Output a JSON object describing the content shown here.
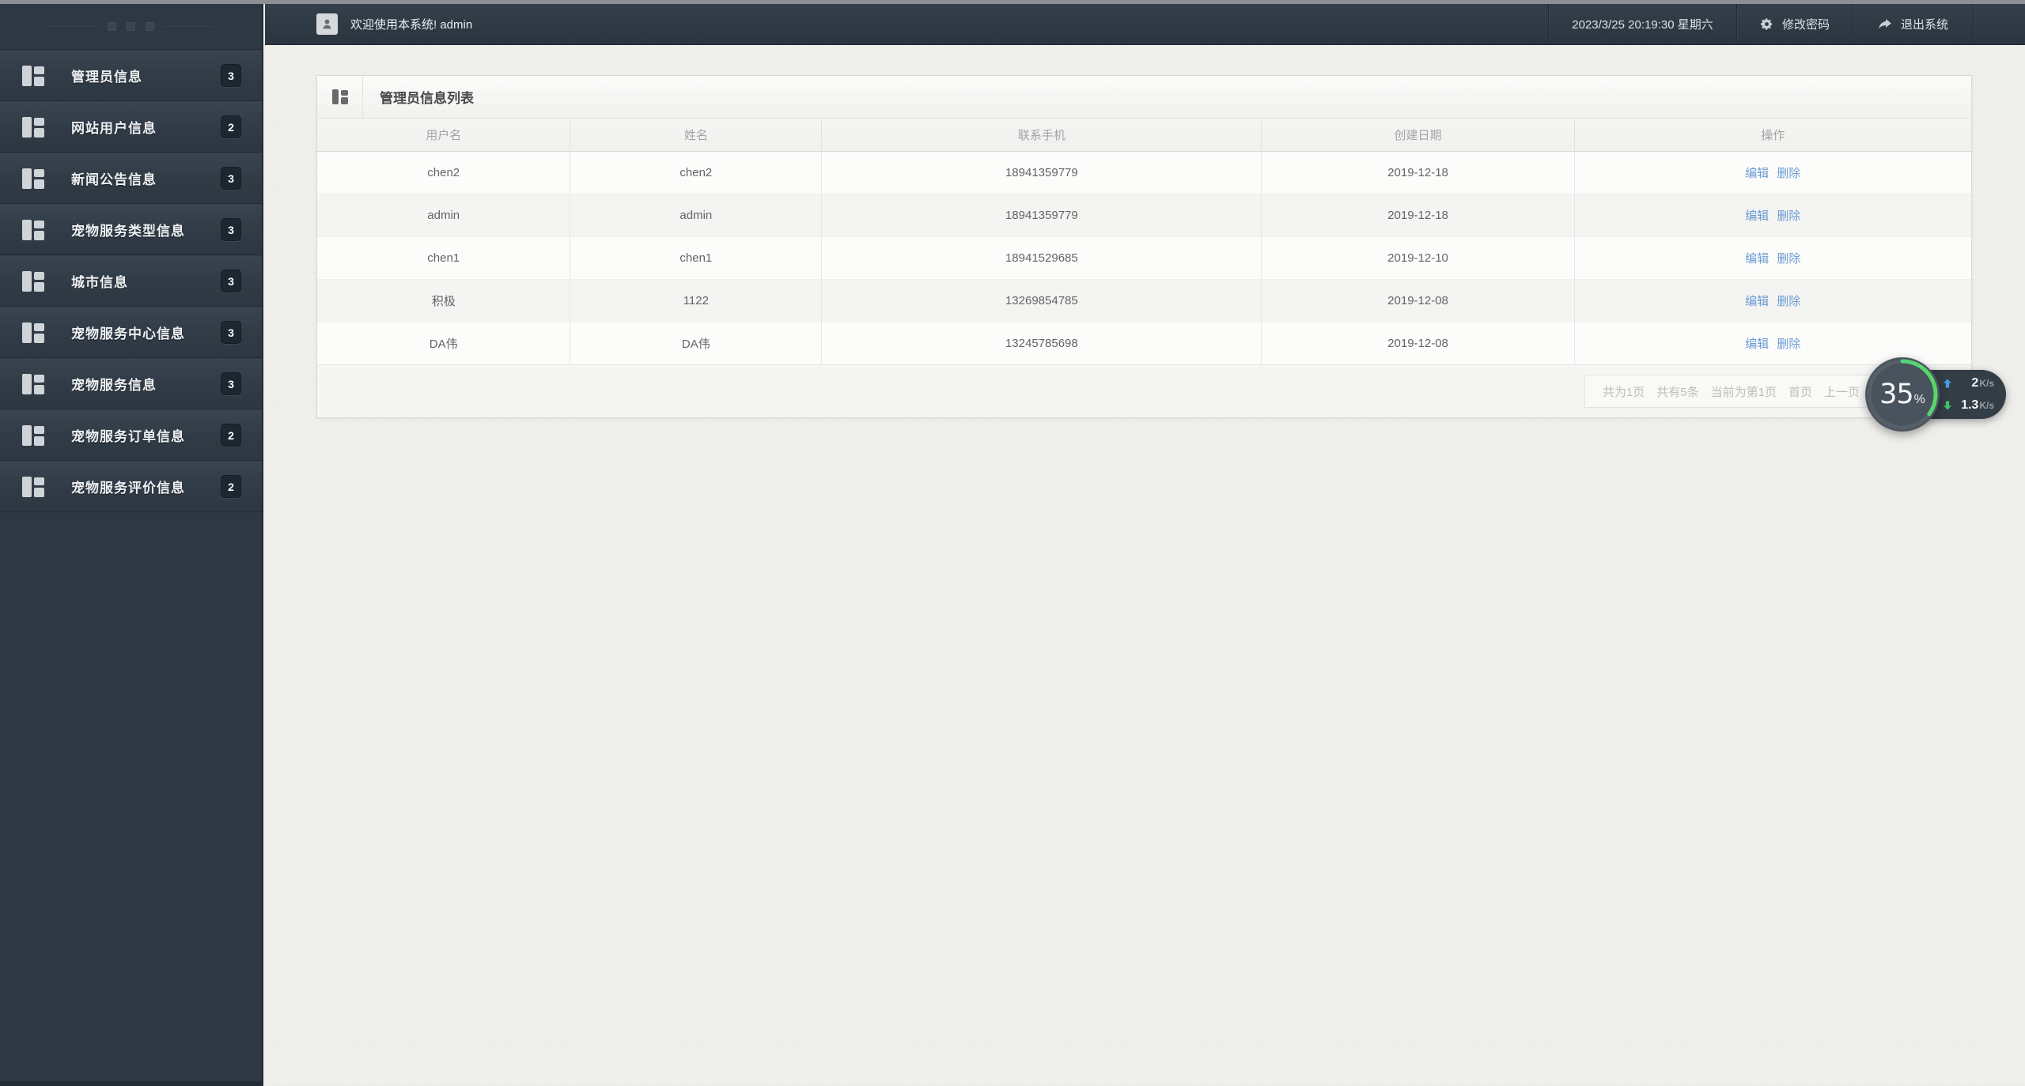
{
  "topbar": {
    "welcome_text": "欢迎使用本系统! admin",
    "datetime": "2023/3/25 20:19:30 星期六",
    "change_password_label": "修改密码",
    "logout_label": "退出系统"
  },
  "sidebar": {
    "items": [
      {
        "label": "管理员信息",
        "badge": "3"
      },
      {
        "label": "网站用户信息",
        "badge": "2"
      },
      {
        "label": "新闻公告信息",
        "badge": "3"
      },
      {
        "label": "宠物服务类型信息",
        "badge": "3"
      },
      {
        "label": "城市信息",
        "badge": "3"
      },
      {
        "label": "宠物服务中心信息",
        "badge": "3"
      },
      {
        "label": "宠物服务信息",
        "badge": "3"
      },
      {
        "label": "宠物服务订单信息",
        "badge": "2"
      },
      {
        "label": "宠物服务评价信息",
        "badge": "2"
      }
    ]
  },
  "panel": {
    "title": "管理员信息列表",
    "table": {
      "columns": [
        "用户名",
        "姓名",
        "联系手机",
        "创建日期",
        "操作"
      ],
      "rows": [
        {
          "username": "chen2",
          "name": "chen2",
          "phone": "18941359779",
          "created": "2019-12-18"
        },
        {
          "username": "admin",
          "name": "admin",
          "phone": "18941359779",
          "created": "2019-12-18"
        },
        {
          "username": "chen1",
          "name": "chen1",
          "phone": "18941529685",
          "created": "2019-12-10"
        },
        {
          "username": "积极",
          "name": "1122",
          "phone": "13269854785",
          "created": "2019-12-08"
        },
        {
          "username": "DA伟",
          "name": "DA伟",
          "phone": "13245785698",
          "created": "2019-12-08"
        }
      ],
      "edit_label": "编辑",
      "delete_label": "删除"
    },
    "pagination": {
      "total_pages": "共为1页",
      "total_records": "共有5条",
      "current_page": "当前为第1页",
      "first_page": "首页",
      "prev_page": "上一页"
    }
  },
  "speed_widget": {
    "percent": "35",
    "percent_sign": "%",
    "upload_value": "2",
    "upload_unit": "K/s",
    "download_value": "1.3",
    "download_unit": "K/s"
  },
  "icons": {
    "sidebar_item": "th-large-icon",
    "panel_title": "th-large-icon",
    "topbar_user": "user-avatar-icon",
    "change_password": "gear-icon",
    "logout": "forward-arrow-icon",
    "upload": "up-arrow-icon",
    "download": "down-arrow-icon"
  },
  "colors": {
    "sidebar_bg": "#2e3842",
    "header_bg": "#2e3944",
    "badge_bg": "#1d2731",
    "link_blue": "#6b9bd2",
    "ring_teal": "#35d6b4",
    "ring_green": "#5ad469",
    "upload_arrow": "#3fa0e8",
    "download_arrow": "#3ec468"
  }
}
